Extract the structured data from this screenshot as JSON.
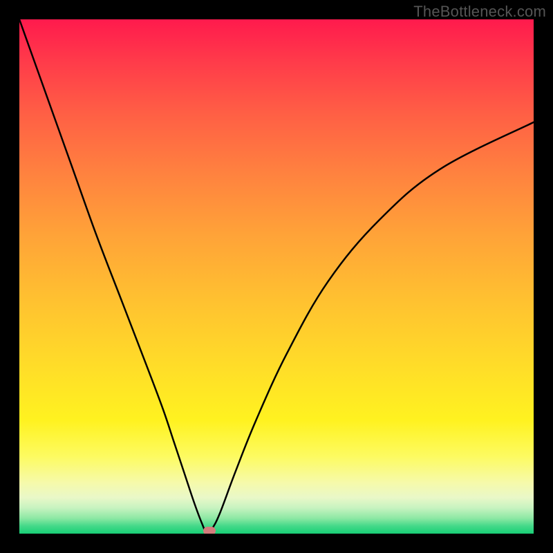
{
  "watermark": "TheBottleneck.com",
  "chart_data": {
    "type": "line",
    "title": "",
    "xlabel": "",
    "ylabel": "",
    "x_range": [
      0,
      100
    ],
    "y_range": [
      0,
      100
    ],
    "series": [
      {
        "name": "bottleneck-curve",
        "x": [
          0,
          5,
          10,
          15,
          20,
          25,
          28,
          30,
          32,
          34,
          35.5,
          36.5,
          37.5,
          39,
          42,
          46,
          52,
          60,
          70,
          82,
          100
        ],
        "y": [
          100,
          86,
          72,
          58,
          45,
          32,
          24,
          18,
          12,
          6,
          2,
          0,
          1,
          4,
          12,
          22,
          35,
          49,
          61,
          71,
          80
        ]
      }
    ],
    "marker": {
      "x": 37,
      "y": 0.5,
      "shape": "pill",
      "color": "#d47d7d"
    },
    "background_gradient": {
      "top": "#ff1a4d",
      "mid": "#ffc230",
      "bottom": "#18cf76"
    }
  }
}
